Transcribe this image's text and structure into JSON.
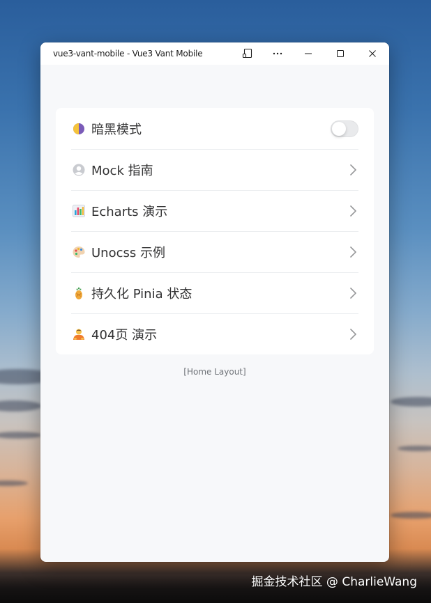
{
  "window": {
    "title": "vue3-vant-mobile - Vue3 Vant Mobile"
  },
  "titlebar_buttons": {
    "cast_icon": "cast-icon",
    "more_icon": "more-icon",
    "minimize_icon": "minimize-icon",
    "maximize_icon": "maximize-icon",
    "close_icon": "close-icon"
  },
  "menu": {
    "items": [
      {
        "icon": "half-moon-icon",
        "label": "暗黑模式",
        "control": "switch",
        "switch_on": false
      },
      {
        "icon": "user-avatar-icon",
        "label": "Mock 指南",
        "control": "arrow"
      },
      {
        "icon": "bar-chart-icon",
        "label": "Echarts 演示",
        "control": "arrow"
      },
      {
        "icon": "palette-icon",
        "label": "Unocss 示例",
        "control": "arrow"
      },
      {
        "icon": "pineapple-icon",
        "label": "持久化 Pinia 状态",
        "control": "arrow"
      },
      {
        "icon": "person-bowing-icon",
        "label": "404页 演示",
        "control": "arrow"
      }
    ]
  },
  "footer": {
    "layout_label": "[Home Layout]"
  },
  "watermark": {
    "text": "掘金技术社区 @ CharlieWang"
  },
  "colors": {
    "page_bg": "#f7f8fa",
    "cell_bg": "#ffffff",
    "label": "#323233",
    "divider": "#ebedf0",
    "arrow": "#969799",
    "switch_off": "#e9eaec"
  }
}
